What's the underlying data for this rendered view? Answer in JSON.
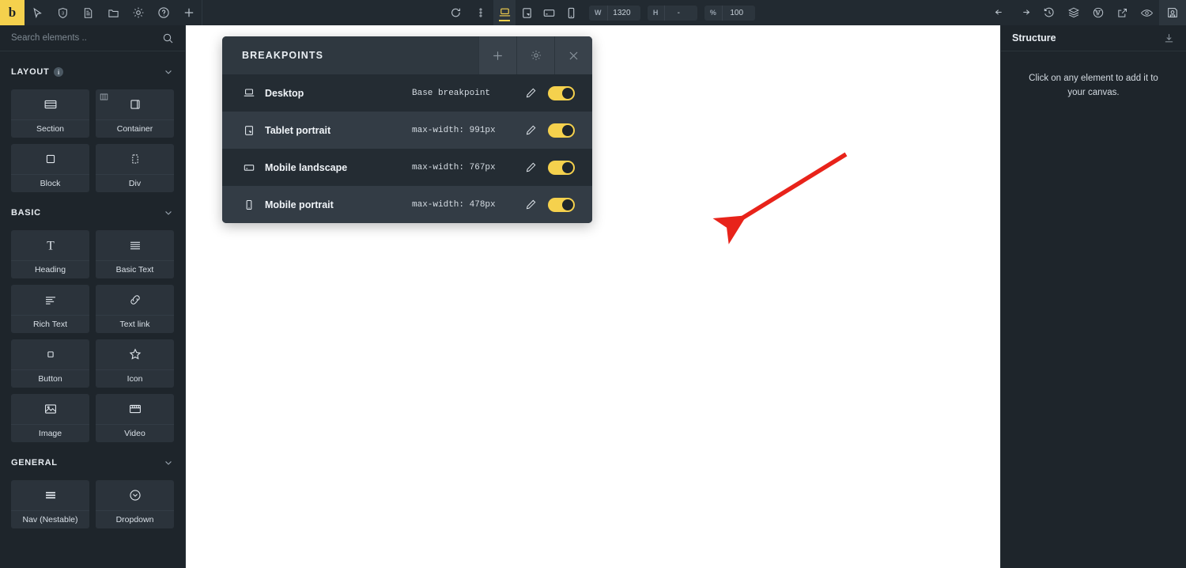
{
  "topbar": {
    "logo_text": "b",
    "left_icons": [
      {
        "name": "cursor-icon",
        "label": "Select"
      },
      {
        "name": "css-shield-icon",
        "label": "CSS"
      },
      {
        "name": "page-icon",
        "label": "Page"
      },
      {
        "name": "folder-icon",
        "label": "Folder"
      },
      {
        "name": "gear-icon",
        "label": "Settings"
      },
      {
        "name": "help-icon",
        "label": "Help"
      },
      {
        "name": "plus-icon",
        "label": "Add"
      }
    ],
    "center": {
      "refresh_label": "Refresh",
      "more_label": "More options",
      "breakpoints": [
        {
          "name": "desktop",
          "label": "Desktop",
          "active": true
        },
        {
          "name": "tablet-portrait",
          "label": "Tablet portrait",
          "active": false
        },
        {
          "name": "mobile-landscape",
          "label": "Mobile landscape",
          "active": false
        },
        {
          "name": "mobile-portrait",
          "label": "Mobile portrait",
          "active": false
        }
      ],
      "width_key": "W",
      "width_value": "1320",
      "height_key": "H",
      "height_value": "-",
      "zoom_key": "%",
      "zoom_value": "100"
    },
    "right_icons": [
      {
        "name": "undo-icon",
        "label": "Undo"
      },
      {
        "name": "redo-icon",
        "label": "Redo"
      },
      {
        "name": "history-icon",
        "label": "History"
      },
      {
        "name": "layers-icon",
        "label": "Layers"
      },
      {
        "name": "wordpress-icon",
        "label": "WordPress"
      },
      {
        "name": "external-link-icon",
        "label": "Open in new tab"
      },
      {
        "name": "eye-icon",
        "label": "Preview"
      },
      {
        "name": "save-icon",
        "label": "Save"
      }
    ]
  },
  "sidebar": {
    "search": {
      "placeholder": "Search elements ..",
      "value": ""
    },
    "groups": [
      {
        "title": "LAYOUT",
        "has_info": true,
        "collapsed": false,
        "items": [
          {
            "label": "Section",
            "icon": "section-icon",
            "badge": null
          },
          {
            "label": "Container",
            "icon": "container-icon",
            "badge": "columns-badge-icon"
          },
          {
            "label": "Block",
            "icon": "block-icon",
            "badge": null
          },
          {
            "label": "Div",
            "icon": "div-icon",
            "badge": null
          }
        ]
      },
      {
        "title": "BASIC",
        "has_info": false,
        "collapsed": false,
        "items": [
          {
            "label": "Heading",
            "icon": "heading-icon",
            "badge": null
          },
          {
            "label": "Basic Text",
            "icon": "basic-text-icon",
            "badge": null
          },
          {
            "label": "Rich Text",
            "icon": "rich-text-icon",
            "badge": null
          },
          {
            "label": "Text link",
            "icon": "link-icon",
            "badge": null
          },
          {
            "label": "Button",
            "icon": "button-icon",
            "badge": null
          },
          {
            "label": "Icon",
            "icon": "star-icon",
            "badge": null
          },
          {
            "label": "Image",
            "icon": "image-icon",
            "badge": null
          },
          {
            "label": "Video",
            "icon": "video-icon",
            "badge": null
          }
        ]
      },
      {
        "title": "GENERAL",
        "has_info": false,
        "collapsed": false,
        "items": [
          {
            "label": "Nav (Nestable)",
            "icon": "hamburger-icon",
            "badge": null
          },
          {
            "label": "Dropdown",
            "icon": "chevron-down-circle-icon",
            "badge": null
          }
        ]
      }
    ]
  },
  "breakpoints_panel": {
    "title": "BREAKPOINTS",
    "add_label": "+",
    "settings_label": "Settings",
    "close_label": "Close",
    "rows": [
      {
        "name": "Desktop",
        "meta": "Base breakpoint",
        "icon": "desktop-icon",
        "enabled": true
      },
      {
        "name": "Tablet portrait",
        "meta": "max-width: 991px",
        "icon": "tablet-portrait-icon",
        "enabled": true
      },
      {
        "name": "Mobile landscape",
        "meta": "max-width: 767px",
        "icon": "mobile-landscape-icon",
        "enabled": true
      },
      {
        "name": "Mobile portrait",
        "meta": "max-width: 478px",
        "icon": "mobile-portrait-icon",
        "enabled": true
      }
    ]
  },
  "structure": {
    "title": "Structure",
    "import_label": "Import",
    "empty_text": "Click on any element to add it to your canvas."
  },
  "colors": {
    "accent": "#f5d14d",
    "panel_bg": "#2c353d",
    "row_dark": "#242c33",
    "row_light": "#333c45",
    "sidebar_bg": "#1e252b",
    "topbar_bg": "#222a31",
    "annotation_arrow": "#e8231a"
  }
}
